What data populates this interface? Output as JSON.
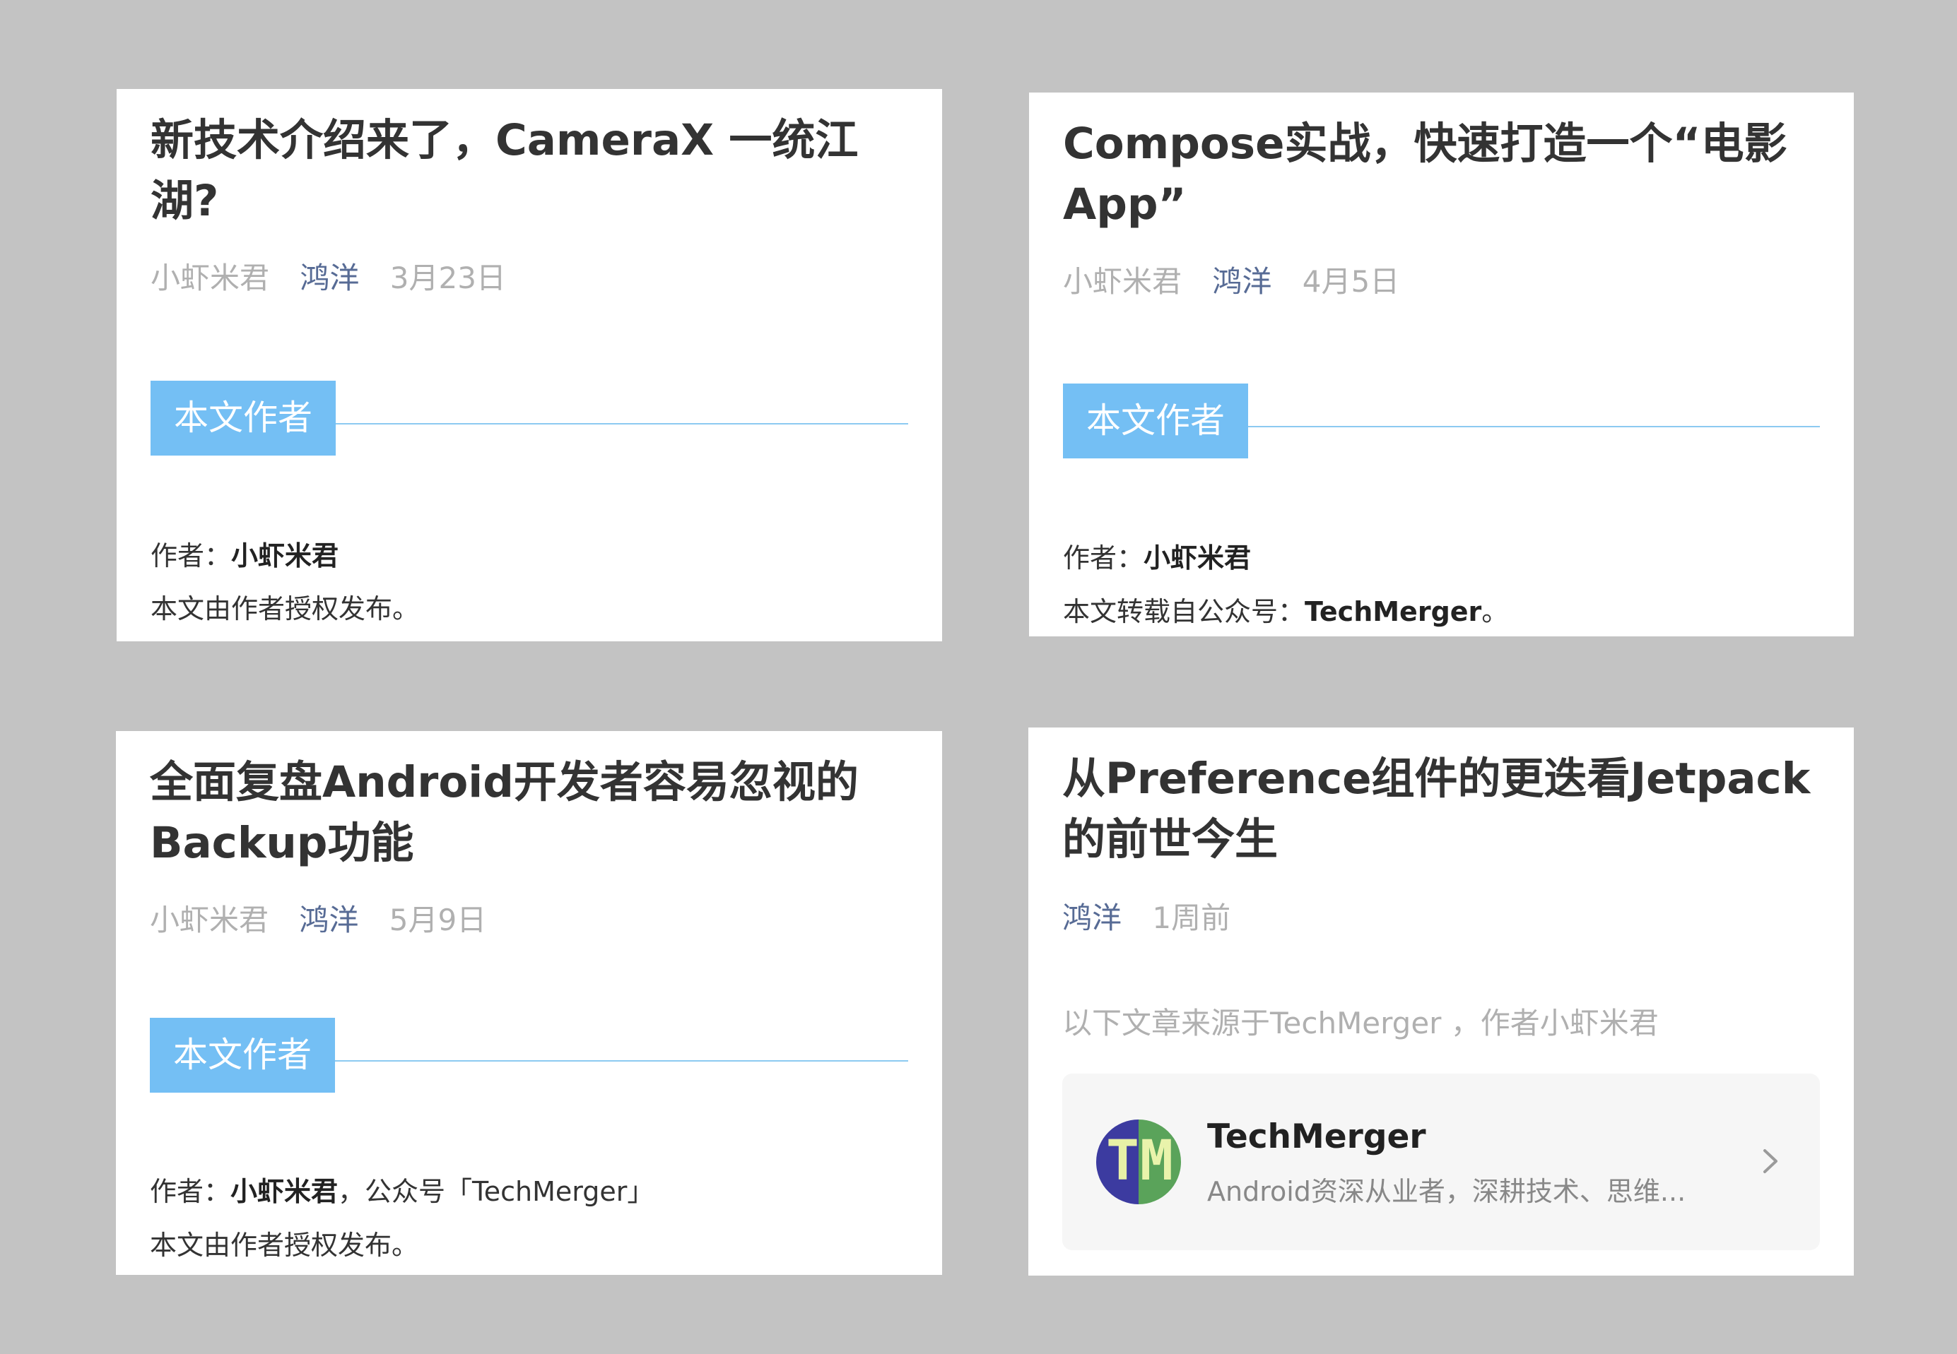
{
  "cards": [
    {
      "title": "新技术介绍来了，CameraX 一统江湖?",
      "meta": {
        "author": "小虾米君",
        "tag": "鸿洋",
        "date": "3月23日"
      },
      "section_label": "本文作者",
      "lines": [
        {
          "prefix": "作者：",
          "strong": "小虾米君",
          "suffix": ""
        },
        {
          "prefix": "本文由作者授权发布。",
          "strong": "",
          "suffix": ""
        }
      ]
    },
    {
      "title": "Compose实战，快速打造一个“电影App”",
      "meta": {
        "author": "小虾米君",
        "tag": "鸿洋",
        "date": "4月5日"
      },
      "section_label": "本文作者",
      "lines": [
        {
          "prefix": "作者：",
          "strong": "小虾米君",
          "suffix": ""
        },
        {
          "prefix": "本文转载自公众号：",
          "strong": "TechMerger",
          "suffix": "。"
        }
      ]
    },
    {
      "title": "全面复盘Android开发者容易忽视的Backup功能",
      "meta": {
        "author": "小虾米君",
        "tag": "鸿洋",
        "date": "5月9日"
      },
      "section_label": "本文作者",
      "lines": [
        {
          "prefix": "作者：",
          "strong": "小虾米君",
          "suffix": "，公众号「TechMerger」"
        },
        {
          "prefix": "本文由作者授权发布。",
          "strong": "",
          "suffix": ""
        }
      ]
    },
    {
      "title": "从Preference组件的更迭看Jetpack的前世今生",
      "meta": {
        "tag": "鸿洋",
        "date": "1周前"
      },
      "source_note": "以下文章来源于TechMerger ，作者小虾米君",
      "profile": {
        "avatar_letters": [
          "T",
          "M"
        ],
        "name": "TechMerger",
        "description": "Android资深从业者，深耕技术、思维...",
        "chevron_icon": "chevron-right-icon"
      }
    }
  ],
  "colors": {
    "background": "#c3c3c3",
    "section_label": "#74bff4",
    "tag_link": "#576b95",
    "muted": "#b0b0b0"
  }
}
